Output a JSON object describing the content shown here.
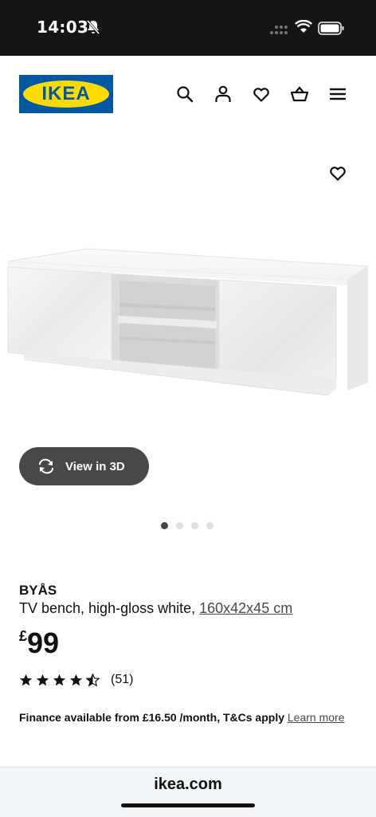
{
  "status_bar": {
    "time": "14:03"
  },
  "header": {
    "logo_text": "IKEA"
  },
  "product": {
    "name": "BYÅS",
    "description": "TV bench, high-gloss white, ",
    "size": "160x42x45 cm",
    "price_currency": "£",
    "price_amount": "99",
    "rating_count": "(51)",
    "rating_stars": 4.5
  },
  "gallery": {
    "view3d_label": "View in 3D",
    "dot_count": 4,
    "active_dot": 1
  },
  "finance": {
    "text": "Finance available from £16.50 /month, T&Cs apply",
    "learn_more": "Learn more"
  },
  "browser": {
    "url": "ikea.com"
  },
  "colors": {
    "ikea_blue": "#0058a3",
    "ikea_yellow": "#ffdb00",
    "button_dark": "#484848"
  }
}
